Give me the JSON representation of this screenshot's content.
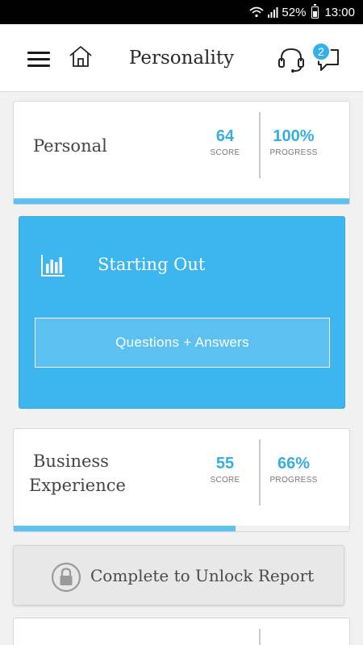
{
  "status_bar": {
    "battery_percent": "52%",
    "time": "13:00",
    "icons": [
      "wifi-icon",
      "signal-icon",
      "battery-icon"
    ]
  },
  "app_bar": {
    "title": "Personality",
    "icons": [
      "menu-icon",
      "home-icon",
      "headset-icon",
      "chat-icon"
    ],
    "chat_badge": "2"
  },
  "sections": [
    {
      "title": "Personal",
      "score": "64",
      "score_label": "SCORE",
      "progress": "100%",
      "progress_label": "PROGRESS",
      "progress_fraction": 1.0
    },
    {
      "title": "Starting Out",
      "icon": "bar-chart-icon",
      "button_label": "Questions + Answers"
    },
    {
      "title_line1": "Business",
      "title_line2": "Experience",
      "score": "55",
      "score_label": "SCORE",
      "progress": "66%",
      "progress_label": "PROGRESS",
      "progress_fraction": 0.66
    }
  ],
  "unlock": {
    "label": "Complete to Unlock Report",
    "icon": "lock-icon"
  },
  "colors": {
    "accent": "#3db5ee",
    "score_text": "#36aee3",
    "progress_bar": "#5ec2ee",
    "status_bar": "#000000",
    "background": "#f1f1f1"
  }
}
